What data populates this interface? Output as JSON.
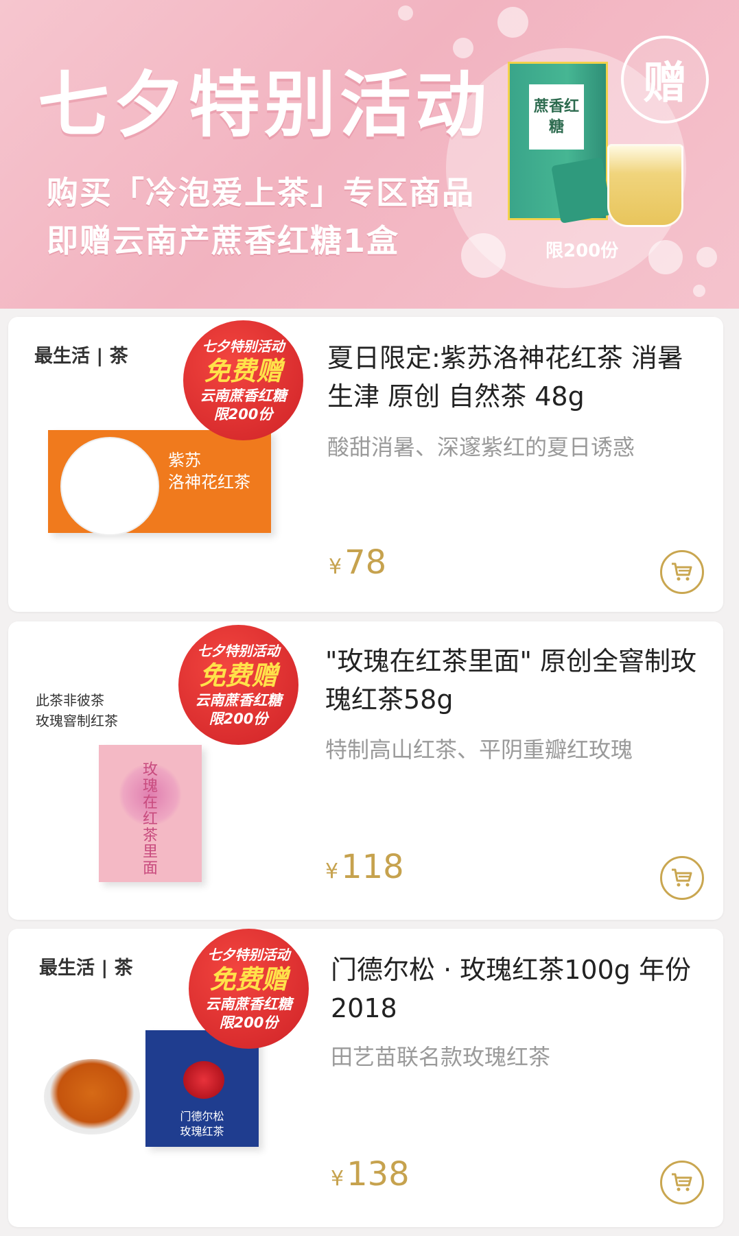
{
  "banner": {
    "title": "七夕特别活动",
    "line1": "购买「冷泡爱上茶」专区商品",
    "line2": "即赠云南产蔗香红糖1盒",
    "gift_badge": "赠",
    "gift_box_label": "蔗香红糖",
    "limit": "限200份"
  },
  "promo": {
    "line1": "七夕特别活动",
    "line2": "免费赠",
    "line3": "云南蔗香红糖",
    "line4": "限200份"
  },
  "products": [
    {
      "brand": "最生活 | 茶",
      "package_text": "紫苏\n洛神花红茶",
      "title": "夏日限定:紫苏洛神花红茶 消暑生津 原创 自然茶 48g",
      "desc": "酸甜消暑、深邃紫红的夏日诱惑",
      "currency": "¥",
      "price": "78"
    },
    {
      "brand_line1": "此茶非彼茶",
      "brand_line2": "玫瑰窨制红茶",
      "package_text": "玫瑰在红茶里面",
      "title": "\"玫瑰在红茶里面\" 原创全窨制玫瑰红茶58g",
      "desc": "特制高山红茶、平阴重瓣红玫瑰",
      "currency": "¥",
      "price": "118"
    },
    {
      "brand": "最生活 | 茶",
      "package_text": "门德尔松\n玫瑰红茶",
      "title": "门德尔松 · 玫瑰红茶100g 年份2018",
      "desc": "田艺苗联名款玫瑰红茶",
      "currency": "¥",
      "price": "138"
    }
  ],
  "colors": {
    "banner_pink": "#f2b3c0",
    "promo_red": "#d82b2d",
    "price_gold": "#c6a24e",
    "desc_gray": "#9a9a9a"
  },
  "icons": [
    "gift-icon",
    "shopping-cart-icon"
  ]
}
